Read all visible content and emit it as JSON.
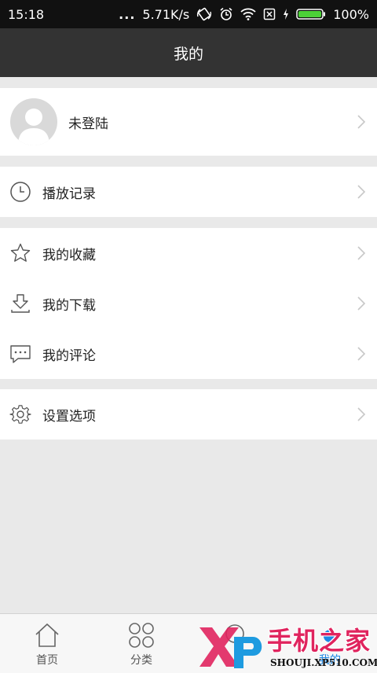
{
  "status_bar": {
    "time": "15:18",
    "dots": "...",
    "speed": "5.71K/s",
    "battery": "100%",
    "icons": [
      "screen-rotate-icon",
      "alarm-icon",
      "wifi-icon",
      "sim-x-icon",
      "charging-icon",
      "battery-icon"
    ]
  },
  "header": {
    "title": "我的"
  },
  "profile": {
    "label": "未登陆",
    "avatar_icon": "avatar-placeholder-icon"
  },
  "menu": {
    "history": {
      "label": "播放记录",
      "icon": "clock-icon"
    },
    "favorites": {
      "label": "我的收藏",
      "icon": "star-icon"
    },
    "downloads": {
      "label": "我的下载",
      "icon": "download-icon"
    },
    "comments": {
      "label": "我的评论",
      "icon": "comment-icon"
    },
    "settings": {
      "label": "设置选项",
      "icon": "gear-icon"
    }
  },
  "tabbar": {
    "tabs": [
      {
        "label": "首页",
        "icon": "home-icon"
      },
      {
        "label": "分类",
        "icon": "grid-icon"
      },
      {
        "label": "",
        "icon": "search-icon"
      },
      {
        "label": "我的",
        "icon": "user-icon"
      }
    ]
  },
  "watermark": {
    "title": "手机之家",
    "subtitle": "SHOUJI.XP510.COM",
    "logo_text": "XP"
  },
  "colors": {
    "titlebar": "#333333",
    "statusbar": "#111111",
    "background": "#e9e9e9",
    "accent_pink": "#e0245e",
    "accent_blue": "#1e88e5"
  }
}
